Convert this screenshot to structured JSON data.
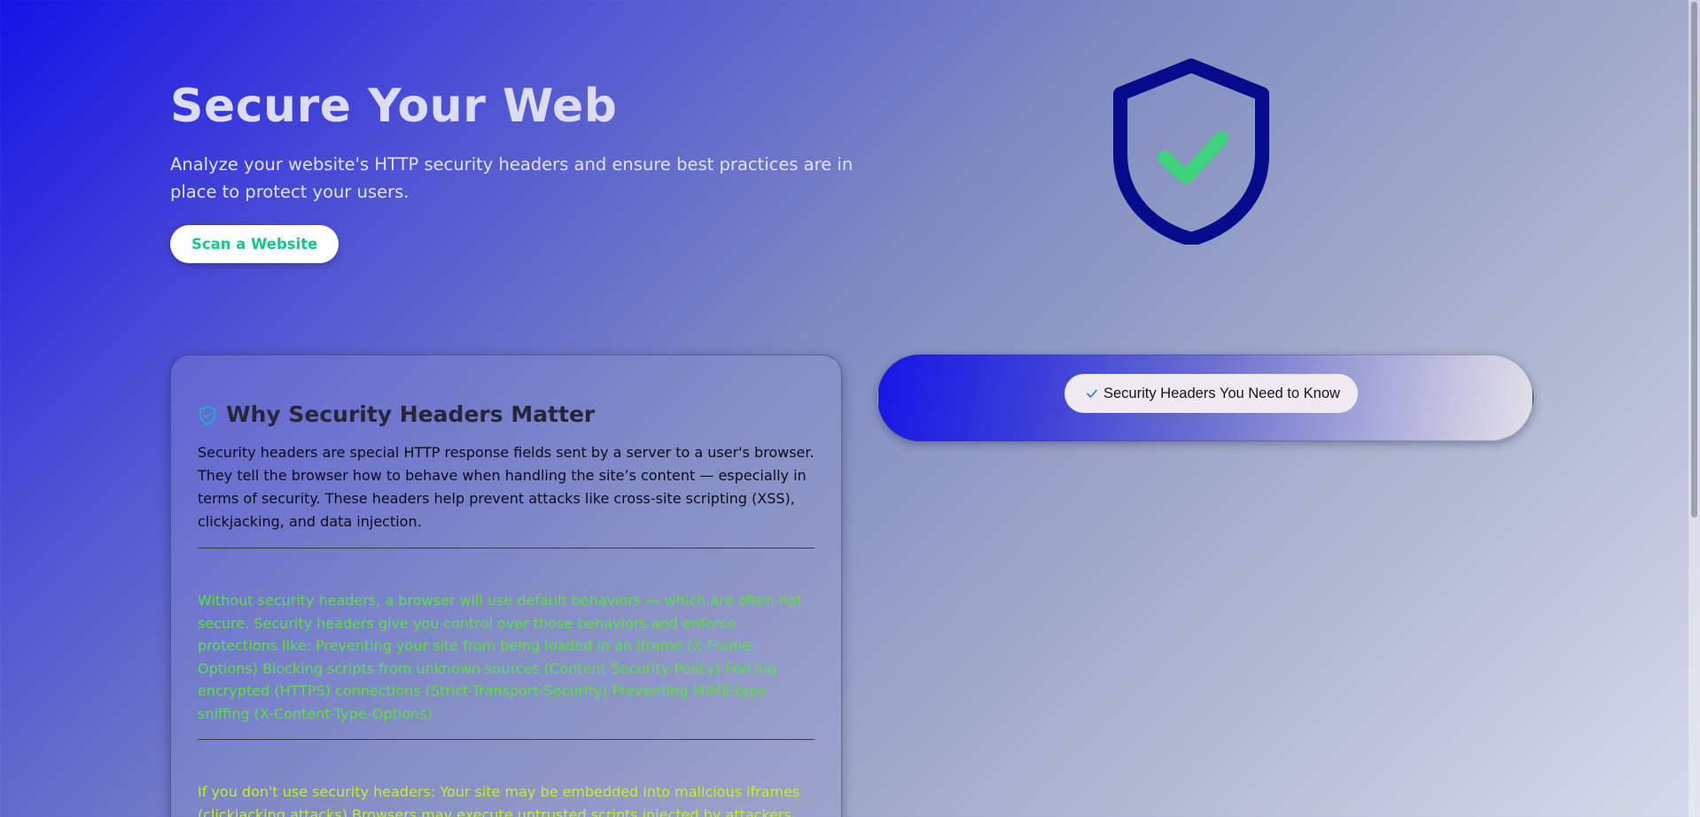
{
  "hero": {
    "title": "Secure Your Web",
    "subtitle": "Analyze your website's HTTP security headers and ensure best practices are in place to protect your users.",
    "scan_button_label": "Scan a Website",
    "shield_icon": "shield-check-icon"
  },
  "card": {
    "title": "Why Security Headers Matter",
    "body": "Security headers are special HTTP response fields sent by a server to a user's browser. They tell the browser how to behave when handling the site’s content — especially in terms of security. These headers help prevent attacks like cross-site scripting (XSS), clickjacking, and data injection.",
    "green_text": "Without security headers, a browser will use default behaviors — which are often not secure. Security headers give you control over those behaviors and enforce protections like: Preventing your site from being loaded in an iframe (X-Frame-Options) Blocking scripts from unknown sources (Content-Security-Policy) Forcing encrypted (HTTPS) connections (Strict-Transport-Security) Preventing MIME-type sniffing (X-Content-Type-Options)",
    "yellow_text": "If you don't use security headers: Your site may be embedded into malicious iframes (clickjacking attacks) Browsers may execute untrusted scripts injected by attackers"
  },
  "pill": {
    "label": "Security Headers You Need to Know"
  },
  "colors": {
    "accent_green": "#10c88a",
    "shield_navy": "#050c8a",
    "check_green": "#3fd37e",
    "text_green": "#5cdf45",
    "text_yellow": "#c6ec2c"
  }
}
